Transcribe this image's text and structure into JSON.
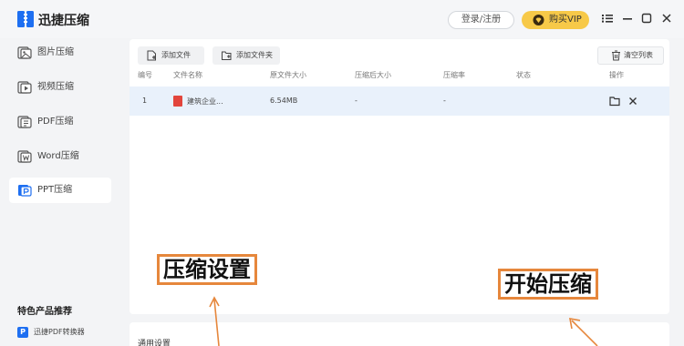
{
  "app": {
    "title": "迅捷压缩"
  },
  "header": {
    "login_label": "登录/注册",
    "vip_label": "购买VIP"
  },
  "sidebar": {
    "items": [
      {
        "label": "图片压缩",
        "icon": "image-icon"
      },
      {
        "label": "视频压缩",
        "icon": "video-icon"
      },
      {
        "label": "PDF压缩",
        "icon": "pdf-icon"
      },
      {
        "label": "Word压缩",
        "icon": "word-icon"
      },
      {
        "label": "PPT压缩",
        "icon": "ppt-icon",
        "active": true
      }
    ],
    "featured_title": "特色产品推荐",
    "featured_items": [
      {
        "label": "迅捷PDF转换器",
        "icon_letter": "P"
      }
    ]
  },
  "toolbar": {
    "add_file": "添加文件",
    "add_folder": "添加文件夹",
    "clear_list": "清空列表"
  },
  "table": {
    "columns": [
      "编号",
      "文件名称",
      "原文件大小",
      "压缩后大小",
      "压缩率",
      "状态",
      "操作"
    ],
    "rows": [
      {
        "index": "1",
        "name": "建筑企业...",
        "original_size": "6.54MB",
        "compressed_size": "-",
        "ratio": "-",
        "status": ""
      }
    ]
  },
  "settings": {
    "title": "通用设置"
  },
  "annotations": {
    "compress_settings": "压缩设置",
    "start_compress": "开始压缩"
  },
  "colors": {
    "accent": "#1e6ff1",
    "vip": "#f7c948",
    "annotation": "#e6873c",
    "row_highlight": "#e9f1fb"
  }
}
